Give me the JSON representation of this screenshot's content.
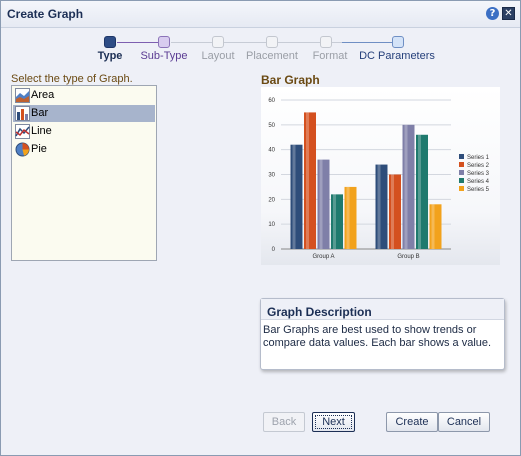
{
  "dialog": {
    "title": "Create Graph",
    "help_icon": "help-icon",
    "close_icon": "close-icon"
  },
  "train": {
    "steps": [
      {
        "label": "Type",
        "state": "current"
      },
      {
        "label": "Sub-Type",
        "state": "visited"
      },
      {
        "label": "Layout",
        "state": "disabled"
      },
      {
        "label": "Placement",
        "state": "disabled"
      },
      {
        "label": "Format",
        "state": "disabled"
      },
      {
        "label": "DC Parameters",
        "state": "target"
      }
    ]
  },
  "type_panel": {
    "label": "Select the type of Graph.",
    "items": [
      {
        "label": "Area",
        "icon": "area-chart-icon",
        "selected": false
      },
      {
        "label": "Bar",
        "icon": "bar-chart-icon",
        "selected": true
      },
      {
        "label": "Line",
        "icon": "line-chart-icon",
        "selected": false
      },
      {
        "label": "Pie",
        "icon": "pie-chart-icon",
        "selected": false
      }
    ]
  },
  "preview": {
    "title": "Bar Graph"
  },
  "chart_data": {
    "type": "bar",
    "title": "",
    "xlabel": "",
    "ylabel": "",
    "categories": [
      "Group A",
      "Group B"
    ],
    "series": [
      {
        "name": "Series 1",
        "values": [
          42,
          34
        ],
        "color": "#2e4d7a"
      },
      {
        "name": "Series 2",
        "values": [
          55,
          30
        ],
        "color": "#d4501f"
      },
      {
        "name": "Series 3",
        "values": [
          36,
          50
        ],
        "color": "#7f7fa8"
      },
      {
        "name": "Series 4",
        "values": [
          22,
          46
        ],
        "color": "#1f7a6e"
      },
      {
        "name": "Series 5",
        "values": [
          25,
          18
        ],
        "color": "#f2a21c"
      }
    ],
    "ylim": [
      0,
      60
    ],
    "yticks": [
      "0",
      "10",
      "20",
      "30",
      "40",
      "50",
      "60"
    ],
    "grid": true,
    "legend": "right"
  },
  "description": {
    "title": "Graph Description",
    "text": "Bar Graphs are best used to show trends or compare data values. Each bar shows a value."
  },
  "buttons": {
    "back": "Back",
    "next": "Next",
    "create": "Create",
    "cancel": "Cancel"
  }
}
